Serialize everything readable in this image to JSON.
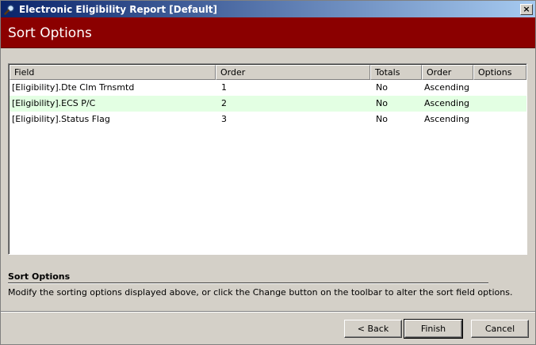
{
  "window": {
    "title": "Electronic Eligibility Report [Default]",
    "close_label": "×"
  },
  "header": {
    "title": "Sort Options"
  },
  "grid": {
    "columns": [
      "Field",
      "Order",
      "Totals",
      "Order",
      "Options"
    ],
    "rows": [
      {
        "field": "[Eligibility].Dte Clm Trnsmtd",
        "order": "1",
        "totals": "No",
        "direction": "Ascending",
        "options": ""
      },
      {
        "field": "[Eligibility].ECS P/C",
        "order": "2",
        "totals": "No",
        "direction": "Ascending",
        "options": ""
      },
      {
        "field": "[Eligibility].Status Flag",
        "order": "3",
        "totals": "No",
        "direction": "Ascending",
        "options": ""
      }
    ]
  },
  "description": {
    "title": "Sort Options",
    "text": "Modify the sorting options displayed above, or click the Change button on the toolbar to alter the sort field options."
  },
  "buttons": {
    "back": "< Back",
    "finish": "Finish",
    "cancel": "Cancel"
  },
  "colors": {
    "header_band": "#8b0000",
    "alt_row": "#e3ffe3",
    "title_bar": "#0a246a"
  }
}
